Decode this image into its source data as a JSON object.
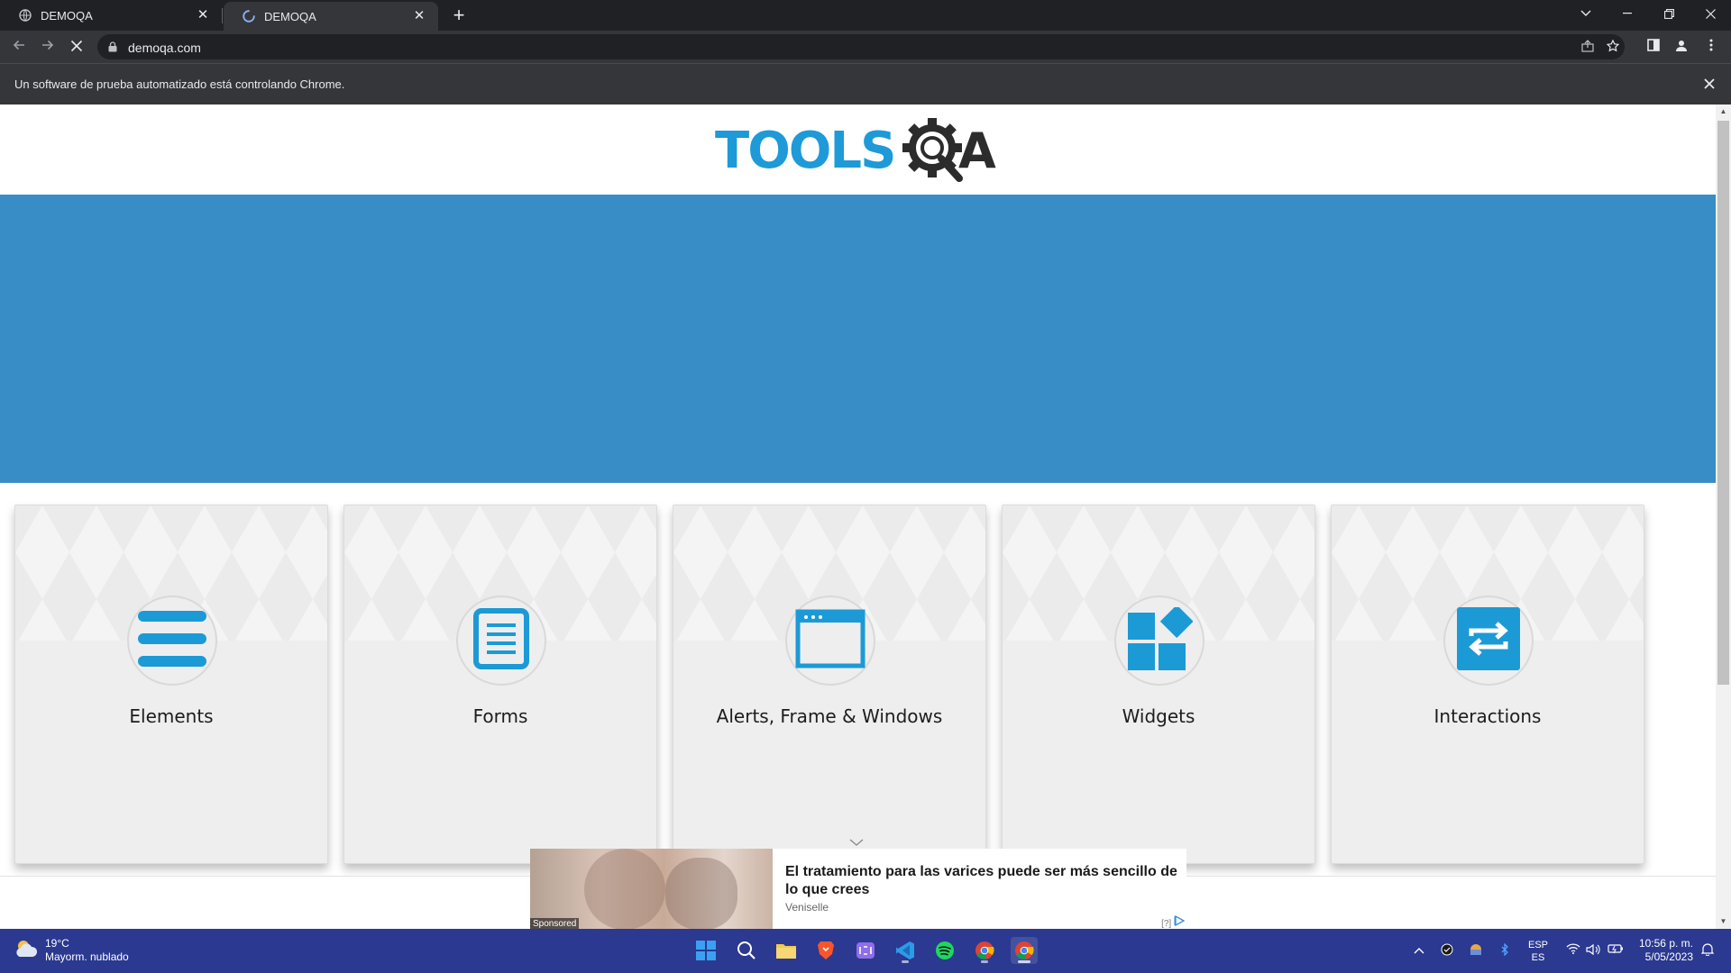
{
  "browser": {
    "tabs": [
      {
        "title": "DEMOQA",
        "active": false,
        "loading": false
      },
      {
        "title": "DEMOQA",
        "active": true,
        "loading": true
      }
    ],
    "url": "demoqa.com",
    "infobar_message": "Un software de prueba automatizado está controlando Chrome."
  },
  "site": {
    "logo_text": "TOOLSQA",
    "colors": {
      "banner": "#388dc6",
      "accent": "#1c9ad6",
      "logo_blue": "#1d9ad7",
      "logo_dark": "#2c2c2c"
    },
    "cards": [
      {
        "title": "Elements",
        "icon": "hamburger-icon"
      },
      {
        "title": "Forms",
        "icon": "document-icon"
      },
      {
        "title": "Alerts, Frame & Windows",
        "icon": "window-icon"
      },
      {
        "title": "Widgets",
        "icon": "widgets-icon"
      },
      {
        "title": "Interactions",
        "icon": "swap-arrows-icon"
      }
    ]
  },
  "ad": {
    "headline": "El tratamiento para las varices puede ser más sencillo de lo que crees",
    "brand": "Veniselle",
    "sponsored_label": "Sponsored",
    "choice_label": "[?]"
  },
  "taskbar": {
    "weather_temp": "19°C",
    "weather_desc": "Mayorm. nublado",
    "lang_top": "ESP",
    "lang_bottom": "ES",
    "time": "10:56 p. m.",
    "date": "5/05/2023"
  }
}
